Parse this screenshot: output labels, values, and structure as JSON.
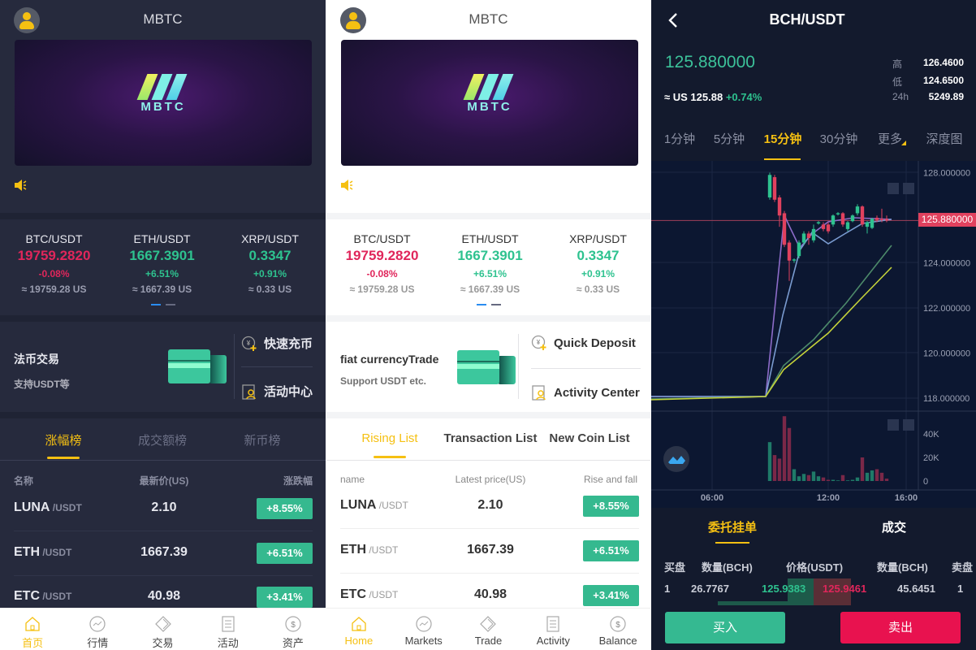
{
  "colors": {
    "accent": "#f5c012",
    "up": "#2ec28f",
    "down": "#e0265b",
    "buy": "#35b991",
    "sell": "#e8124f"
  },
  "logo_text": "MBTC",
  "home_cn": {
    "title": "MBTC",
    "tickers": [
      {
        "pair": "BTC/USDT",
        "price": "19759.2820",
        "change": "-0.08%",
        "approx": "≈ 19759.28 US",
        "dir": "down"
      },
      {
        "pair": "ETH/USDT",
        "price": "1667.3901",
        "change": "+6.51%",
        "approx": "≈ 1667.39 US",
        "dir": "up"
      },
      {
        "pair": "XRP/USDT",
        "price": "0.3347",
        "change": "+0.91%",
        "approx": "≈ 0.33 US",
        "dir": "up"
      }
    ],
    "fiat_title": "法币交易",
    "fiat_sub": "支持USDT等",
    "quick_deposit": "快速充币",
    "activity_center": "活动中心",
    "tabs": [
      "涨幅榜",
      "成交额榜",
      "新币榜"
    ],
    "headers": [
      "名称",
      "最新价(US)",
      "涨跌幅"
    ],
    "rows": [
      {
        "coin": "LUNA",
        "quote": " /USDT",
        "price": "2.10",
        "change": "+8.55%"
      },
      {
        "coin": "ETH",
        "quote": " /USDT",
        "price": "1667.39",
        "change": "+6.51%"
      },
      {
        "coin": "ETC",
        "quote": " /USDT",
        "price": "40.98",
        "change": "+3.41%"
      }
    ],
    "nav": [
      "首页",
      "行情",
      "交易",
      "活动",
      "资产"
    ]
  },
  "home_en": {
    "title": "MBTC",
    "tickers": [
      {
        "pair": "BTC/USDT",
        "price": "19759.2820",
        "change": "-0.08%",
        "approx": "≈ 19759.28 US",
        "dir": "down"
      },
      {
        "pair": "ETH/USDT",
        "price": "1667.3901",
        "change": "+6.51%",
        "approx": "≈ 1667.39 US",
        "dir": "up"
      },
      {
        "pair": "XRP/USDT",
        "price": "0.3347",
        "change": "+0.91%",
        "approx": "≈ 0.33 US",
        "dir": "up"
      }
    ],
    "fiat_title": "fiat currencyTrade",
    "fiat_sub": "Support USDT etc.",
    "quick_deposit": "Quick Deposit",
    "activity_center": "Activity Center",
    "tabs": [
      "Rising List",
      "Transaction List",
      "New Coin List"
    ],
    "headers": [
      "name",
      "Latest price(US)",
      "Rise and fall"
    ],
    "rows": [
      {
        "coin": "LUNA",
        "quote": " /USDT",
        "price": "2.10",
        "change": "+8.55%"
      },
      {
        "coin": "ETH",
        "quote": " /USDT",
        "price": "1667.39",
        "change": "+6.51%"
      },
      {
        "coin": "ETC",
        "quote": " /USDT",
        "price": "40.98",
        "change": "+3.41%"
      }
    ],
    "nav": [
      "Home",
      "Markets",
      "Trade",
      "Activity",
      "Balance"
    ]
  },
  "trade": {
    "pair": "BCH/USDT",
    "last_price": "125.880000",
    "approx": "≈ US 125.88",
    "change": "+0.74%",
    "stats": [
      {
        "label": "高",
        "value": "126.4600"
      },
      {
        "label": "低",
        "value": "124.6500"
      },
      {
        "label": "24h",
        "value": "5249.89"
      }
    ],
    "timeframes": [
      "1分钟",
      "5分钟",
      "15分钟",
      "30分钟",
      "更多",
      "深度图"
    ],
    "active_timeframe": "15分钟",
    "price_ticks": [
      "128.000000",
      "124.000000",
      "122.000000",
      "120.000000",
      "118.000000"
    ],
    "price_tag": "125.880000",
    "volume_ticks": [
      "40K",
      "20K",
      "0"
    ],
    "time_ticks": [
      "06:00",
      "12:00",
      "16:00"
    ],
    "candles": [
      [
        126.9,
        128.0,
        126.8,
        127.9
      ],
      [
        127.8,
        127.9,
        126.7,
        126.8
      ],
      [
        126.9,
        127.0,
        125.6,
        126.1
      ],
      [
        126.2,
        126.3,
        124.7,
        124.8
      ],
      [
        124.9,
        125.0,
        123.2,
        124.1
      ],
      [
        124.1,
        124.2,
        124.0,
        124.15
      ],
      [
        124.3,
        125.0,
        124.2,
        124.9
      ],
      [
        124.9,
        125.4,
        124.8,
        125.3
      ],
      [
        125.3,
        125.4,
        124.8,
        125.1
      ],
      [
        125.0,
        125.7,
        124.9,
        125.5
      ],
      [
        125.75,
        125.85,
        125.7,
        125.8
      ],
      [
        125.7,
        125.8,
        125.4,
        125.5
      ],
      [
        125.7,
        125.8,
        125.3,
        125.4
      ],
      [
        125.7,
        126.15,
        125.6,
        126.1
      ],
      [
        126.15,
        126.25,
        126.1,
        126.2
      ],
      [
        126.2,
        126.25,
        125.6,
        125.7
      ],
      [
        125.5,
        125.85,
        125.4,
        125.8
      ],
      [
        125.85,
        126.15,
        125.8,
        126.1
      ],
      [
        126.2,
        126.6,
        126.1,
        126.5
      ],
      [
        126.5,
        126.55,
        125.6,
        125.7
      ],
      [
        125.6,
        125.85,
        125.3,
        125.8
      ],
      [
        125.55,
        126.0,
        125.5,
        125.95
      ],
      [
        126.0,
        126.1,
        125.8,
        125.9
      ],
      [
        125.95,
        126.4,
        125.8,
        125.9
      ],
      [
        125.95,
        126.1,
        125.8,
        125.88
      ]
    ],
    "volumes": [
      33,
      22,
      19,
      55,
      45,
      10,
      4,
      6,
      5,
      8,
      4,
      3,
      1,
      1,
      0.5,
      5,
      0.5,
      1,
      3,
      20,
      7,
      9,
      10,
      7,
      2
    ],
    "order_tabs": [
      "委托挂单",
      "成交"
    ],
    "order_headers": [
      "买盘",
      "数量(BCH)",
      "价格(USDT)",
      "数量(BCH)",
      "卖盘"
    ],
    "order_row": {
      "buy_idx": "1",
      "buy_qty": "26.7767",
      "bid": "125.9383",
      "ask": "125.9461",
      "sell_qty": "45.6451",
      "sell_idx": "1"
    },
    "buy_label": "买入",
    "sell_label": "卖出"
  }
}
